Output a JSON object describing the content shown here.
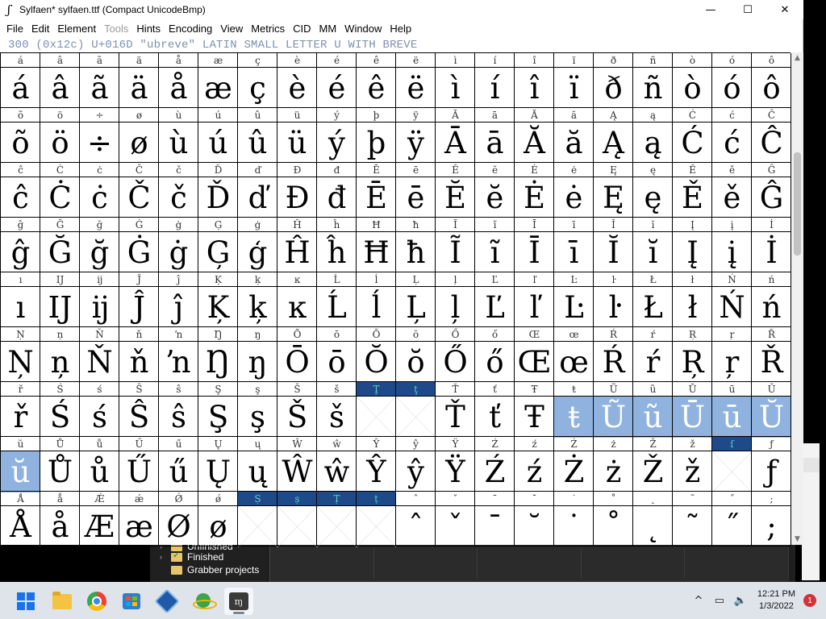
{
  "window": {
    "title": "Sylfaen*  sylfaen.ttf (Compact UnicodeBmp)",
    "icon": "fontforge-f-icon",
    "controls": {
      "minimize": "—",
      "maximize": "☐",
      "close": "✕"
    }
  },
  "menu": [
    {
      "label": "File",
      "key": "F",
      "disabled": false
    },
    {
      "label": "Edit",
      "key": "E",
      "disabled": false
    },
    {
      "label": "Element",
      "key": "l",
      "disabled": false
    },
    {
      "label": "Tools",
      "key": "T",
      "disabled": true
    },
    {
      "label": "Hints",
      "key": "i",
      "disabled": false
    },
    {
      "label": "Encoding",
      "key": "n",
      "disabled": false
    },
    {
      "label": "View",
      "key": "V",
      "disabled": false
    },
    {
      "label": "Metrics",
      "key": "M",
      "disabled": false
    },
    {
      "label": "CID",
      "key": "C",
      "disabled": false
    },
    {
      "label": "MM",
      "key": "",
      "disabled": false
    },
    {
      "label": "Window",
      "key": "W",
      "disabled": false
    },
    {
      "label": "Help",
      "key": "H",
      "disabled": false
    }
  ],
  "info_line": "300 (0x12c) U+016D \"ubreve\" LATIN SMALL LETTER U WITH BREVE",
  "glyph_grid": {
    "columns": 20,
    "rows": [
      {
        "labels": [
          "á",
          "â",
          "ã",
          "ä",
          "å",
          "æ",
          "ç",
          "è",
          "é",
          "ê",
          "ë",
          "ì",
          "í",
          "î",
          "ï",
          "ð",
          "ñ",
          "ò",
          "ó",
          "ô"
        ],
        "glyphs": [
          "á",
          "â",
          "ã",
          "ä",
          "å",
          "æ",
          "ç",
          "è",
          "é",
          "ê",
          "ë",
          "ì",
          "í",
          "î",
          "ï",
          "ð",
          "ñ",
          "ò",
          "ó",
          "ô"
        ]
      },
      {
        "labels": [
          "õ",
          "ö",
          "÷",
          "ø",
          "ù",
          "ú",
          "û",
          "ü",
          "ý",
          "þ",
          "ÿ",
          "Ā",
          "ā",
          "Ă",
          "ă",
          "Ą",
          "ą",
          "Ć",
          "ć",
          "Ĉ"
        ],
        "glyphs": [
          "õ",
          "ö",
          "÷",
          "ø",
          "ù",
          "ú",
          "û",
          "ü",
          "ý",
          "þ",
          "ÿ",
          "Ā",
          "ā",
          "Ă",
          "ă",
          "Ą",
          "ą",
          "Ć",
          "ć",
          "Ĉ"
        ]
      },
      {
        "labels": [
          "ĉ",
          "Ċ",
          "ċ",
          "Č",
          "č",
          "Ď",
          "ď",
          "Đ",
          "đ",
          "Ē",
          "ē",
          "Ĕ",
          "ĕ",
          "Ė",
          "ė",
          "Ę",
          "ę",
          "Ě",
          "ě",
          "Ĝ"
        ],
        "glyphs": [
          "ĉ",
          "Ċ",
          "ċ",
          "Č",
          "č",
          "Ď",
          "ď",
          "Đ",
          "đ",
          "Ē",
          "ē",
          "Ĕ",
          "ĕ",
          "Ė",
          "ė",
          "Ę",
          "ę",
          "Ě",
          "ě",
          "Ĝ"
        ]
      },
      {
        "labels": [
          "ĝ",
          "Ğ",
          "ğ",
          "Ġ",
          "ġ",
          "Ģ",
          "ģ",
          "Ĥ",
          "ĥ",
          "Ħ",
          "ħ",
          "Ĩ",
          "ĩ",
          "Ī",
          "ī",
          "Ĭ",
          "ĭ",
          "Į",
          "į",
          "İ"
        ],
        "glyphs": [
          "ĝ",
          "Ğ",
          "ğ",
          "Ġ",
          "ġ",
          "Ģ",
          "ģ",
          "Ĥ",
          "ĥ",
          "Ħ",
          "ħ",
          "Ĩ",
          "ĩ",
          "Ī",
          "ī",
          "Ĭ",
          "ĭ",
          "Į",
          "į",
          "İ"
        ]
      },
      {
        "labels": [
          "ı",
          "Ĳ",
          "ĳ",
          "Ĵ",
          "ĵ",
          "Ķ",
          "ķ",
          "ĸ",
          "Ĺ",
          "ĺ",
          "Ļ",
          "ļ",
          "Ľ",
          "ľ",
          "Ŀ",
          "ŀ",
          "Ł",
          "ł",
          "Ń",
          "ń"
        ],
        "glyphs": [
          "ı",
          "Ĳ",
          "ĳ",
          "Ĵ",
          "ĵ",
          "Ķ",
          "ķ",
          "ĸ",
          "Ĺ",
          "ĺ",
          "Ļ",
          "ļ",
          "Ľ",
          "ľ",
          "Ŀ",
          "ŀ",
          "Ł",
          "ł",
          "Ń",
          "ń"
        ]
      },
      {
        "labels": [
          "Ņ",
          "ņ",
          "Ň",
          "ň",
          "ŉ",
          "Ŋ",
          "ŋ",
          "Ō",
          "ō",
          "Ŏ",
          "ŏ",
          "Ő",
          "ő",
          "Œ",
          "œ",
          "Ŕ",
          "ŕ",
          "Ŗ",
          "ŗ",
          "Ř"
        ],
        "glyphs": [
          "Ņ",
          "ņ",
          "Ň",
          "ň",
          "ŉ",
          "Ŋ",
          "ŋ",
          "Ō",
          "ō",
          "Ŏ",
          "ŏ",
          "Ő",
          "ő",
          "Œ",
          "œ",
          "Ŕ",
          "ŕ",
          "Ŗ",
          "ŗ",
          "Ř"
        ]
      },
      {
        "labels": [
          "ř",
          "Ś",
          "ś",
          "Ŝ",
          "ŝ",
          "Ş",
          "ş",
          "Š",
          "š",
          "Ţ",
          "ţ",
          "Ť",
          "ť",
          "Ŧ",
          "ŧ",
          "Ũ",
          "ũ",
          "Ū",
          "ū",
          "Ŭ"
        ],
        "glyphs": [
          "ř",
          "Ś",
          "ś",
          "Ŝ",
          "ŝ",
          "Ş",
          "ş",
          "Š",
          "š",
          "",
          "",
          "Ť",
          "ť",
          "Ŧ",
          "ŧ",
          "Ũ",
          "ũ",
          "Ū",
          "ū",
          "Ŭ"
        ],
        "label_selected": [
          9,
          10
        ],
        "glyph_selected": [
          14,
          15,
          16,
          17,
          18,
          19
        ],
        "empty": [
          9,
          10
        ]
      },
      {
        "labels": [
          "ŭ",
          "Ů",
          "ů",
          "Ű",
          "ű",
          "Ų",
          "ų",
          "Ŵ",
          "ŵ",
          "Ŷ",
          "ŷ",
          "Ÿ",
          "Ź",
          "ź",
          "Ż",
          "ż",
          "Ž",
          "ž",
          "ſ",
          "ƒ"
        ],
        "glyphs": [
          "ŭ",
          "Ů",
          "ů",
          "Ű",
          "ű",
          "Ų",
          "ų",
          "Ŵ",
          "ŵ",
          "Ŷ",
          "ŷ",
          "Ÿ",
          "Ź",
          "ź",
          "Ż",
          "ż",
          "Ž",
          "ž",
          "",
          "ƒ"
        ],
        "label_selected": [
          18
        ],
        "glyph_selected": [
          0
        ],
        "empty": [
          18
        ]
      },
      {
        "labels": [
          "Ǻ",
          "ǻ",
          "Ǽ",
          "ǽ",
          "Ǿ",
          "ǿ",
          "Ș",
          "ș",
          "Ț",
          "ț",
          "ˆ",
          "ˇ",
          "ˉ",
          "˘",
          "˙",
          "˚",
          "˛",
          "˜",
          "˝",
          ";"
        ],
        "glyphs": [
          "Å",
          "å",
          "Æ",
          "æ",
          "Ø",
          "ø",
          "",
          "",
          "",
          "",
          "ˆ",
          "ˇ",
          "ˉ",
          "˘",
          "˙",
          "˚",
          "˛",
          "˜",
          "˝",
          ";"
        ],
        "label_selected": [
          6,
          7,
          8,
          9
        ],
        "glyph_selected": [],
        "empty": [
          6,
          7,
          8,
          9
        ]
      }
    ]
  },
  "background_explorer": {
    "tree_items": [
      "Unfinished",
      "Finished",
      "Grabber projects"
    ]
  },
  "taskbar": {
    "apps": [
      {
        "name": "start-button",
        "active": false
      },
      {
        "name": "file-explorer",
        "active": false
      },
      {
        "name": "chrome",
        "active": false
      },
      {
        "name": "microsoft-store",
        "active": false
      },
      {
        "name": "virtualbox",
        "active": false
      },
      {
        "name": "network-app",
        "active": false
      },
      {
        "name": "fontforge",
        "active": true
      }
    ],
    "tray_symbols": [
      "^",
      "▭",
      "🔈"
    ],
    "time": "12:21 PM",
    "date": "1/3/2022",
    "notification_count": "1"
  },
  "colors": {
    "selection_label_bg": "#1e4a8a",
    "selection_label_fg": "#5ad0c8",
    "selection_cell_bg": "#8fb3de",
    "info_text": "#7d8fb0"
  }
}
